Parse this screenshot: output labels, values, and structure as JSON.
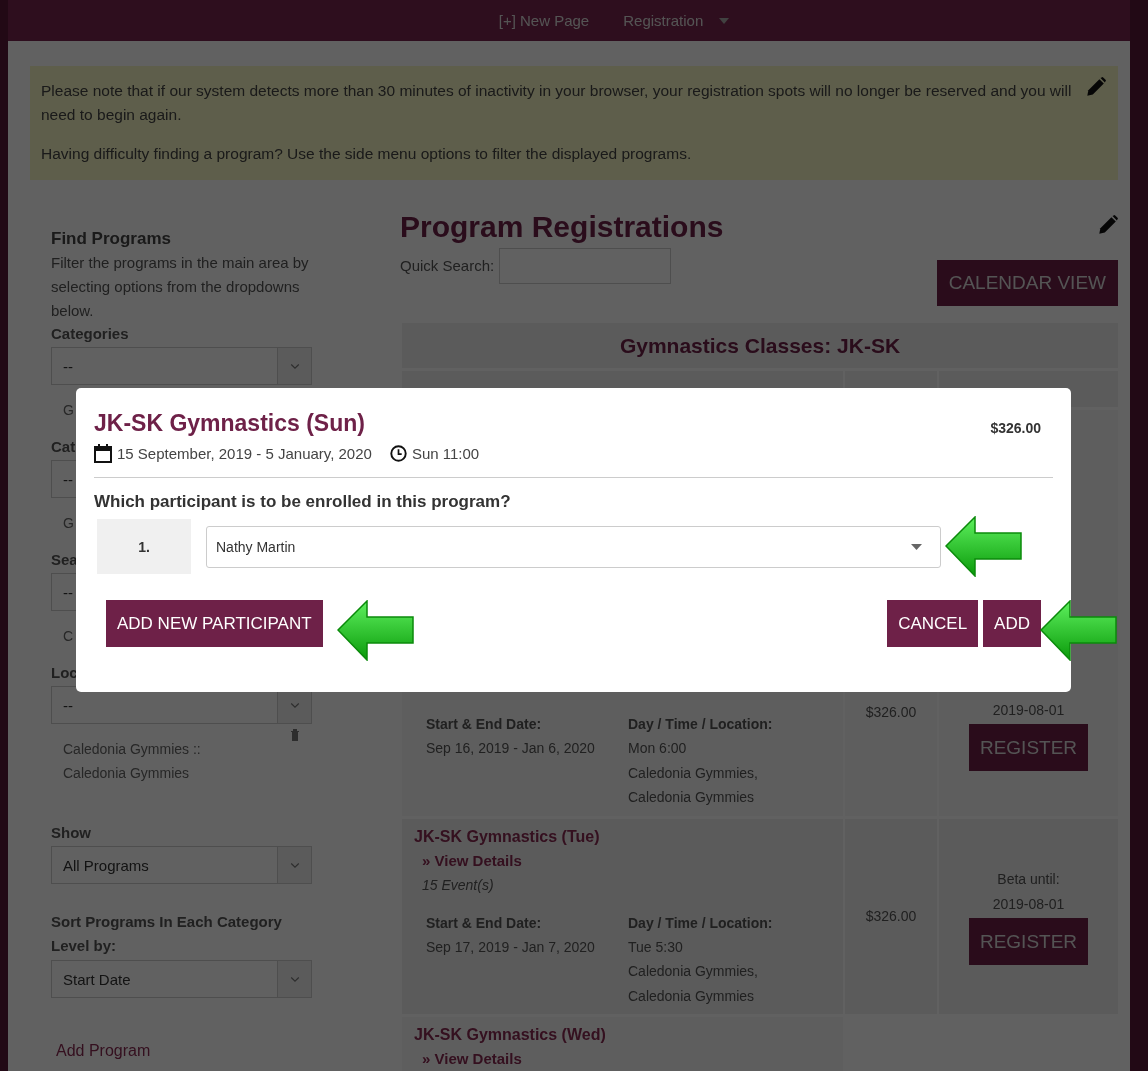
{
  "nav": {
    "items": [
      {
        "label": "[+] New Page",
        "dropdown": false
      },
      {
        "label": "Registration",
        "dropdown": true
      }
    ]
  },
  "notice": {
    "paragraphs": [
      "Please note that if our system detects more than 30 minutes of inactivity in your browser, your registration spots will no longer be reserved and you will need to begin again.",
      "Having difficulty finding a program? Use the side menu options to filter the displayed programs."
    ]
  },
  "sidebar": {
    "title": "Find Programs",
    "description": "Filter the programs in the main area by selecting options from the dropdowns below.",
    "filters": [
      {
        "label": "Categories",
        "value": "--",
        "notes": [
          "G"
        ],
        "removable": false
      },
      {
        "label": "Cat",
        "value": "--",
        "notes": [
          "G"
        ],
        "removable": false
      },
      {
        "label": "Sea",
        "value": "--",
        "notes": [
          "C"
        ],
        "removable": false
      },
      {
        "label": "Loc",
        "value": "--",
        "notes": [
          "Caledonia Gymmies ::",
          "Caledonia Gymmies"
        ],
        "removable": true
      }
    ],
    "show": {
      "label": "Show",
      "value": "All Programs"
    },
    "sort": {
      "label": "Sort Programs In Each Category Level by:",
      "value": "Start Date"
    },
    "add_link": "Add Program"
  },
  "main": {
    "title": "Program Registrations",
    "search_label": "Quick Search:",
    "calendar_button": "CALENDAR VIEW",
    "table": {
      "heading": "Gymnastics Classes: JK-SK",
      "rows": [
        {
          "start_end_label": "Start & End Date:",
          "dates": "Sep 16, 2019 - Jan 6, 2020",
          "day_time_label": "Day / Time / Location:",
          "day_time_lines": [
            "Mon 6:00",
            "Caledonia Gymmies,",
            "Caledonia Gymmies"
          ],
          "fee": "$326.00",
          "availability": [
            "2019-08-01"
          ],
          "button": "REGISTER"
        },
        {
          "name": "JK-SK Gymnastics (Tue)",
          "details_link": "» View Details",
          "events": "15 Event(s)",
          "start_end_label": "Start & End Date:",
          "dates": "Sep 17, 2019 - Jan 7, 2020",
          "day_time_label": "Day / Time / Location:",
          "day_time_lines": [
            "Tue 5:30",
            "Caledonia Gymmies,",
            "Caledonia Gymmies"
          ],
          "fee": "$326.00",
          "availability": [
            "Beta until:",
            "2019-08-01"
          ],
          "button": "REGISTER"
        },
        {
          "name": "JK-SK Gymnastics (Wed)",
          "details_link": "» View Details"
        }
      ]
    }
  },
  "modal": {
    "title": "JK-SK Gymnastics (Sun)",
    "price": "$326.00",
    "dates": "15 September, 2019 - 5 January, 2020",
    "time": "Sun 11:00",
    "question": "Which participant is to be enrolled in this program?",
    "participants": [
      {
        "number": "1.",
        "name": "Nathy Martin"
      }
    ],
    "buttons_left": [
      "ADD NEW PARTICIPANT"
    ],
    "buttons_right": [
      "CANCEL",
      "ADD"
    ]
  }
}
